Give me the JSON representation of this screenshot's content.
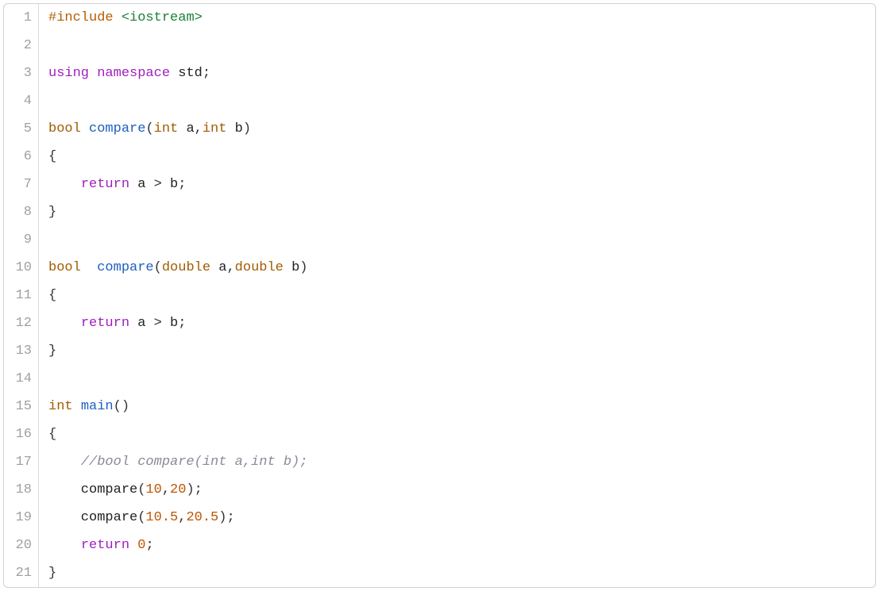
{
  "code": {
    "lines": [
      {
        "n": "1",
        "tokens": [
          {
            "cls": "tok-preproc",
            "txt": "#include"
          },
          {
            "cls": "tok-plain",
            "txt": " "
          },
          {
            "cls": "tok-incstr",
            "txt": "<iostream>"
          }
        ]
      },
      {
        "n": "2",
        "tokens": []
      },
      {
        "n": "3",
        "tokens": [
          {
            "cls": "tok-keyword",
            "txt": "using"
          },
          {
            "cls": "tok-plain",
            "txt": " "
          },
          {
            "cls": "tok-keyword",
            "txt": "namespace"
          },
          {
            "cls": "tok-plain",
            "txt": " std"
          },
          {
            "cls": "tok-punct",
            "txt": ";"
          }
        ]
      },
      {
        "n": "4",
        "tokens": []
      },
      {
        "n": "5",
        "tokens": [
          {
            "cls": "tok-type",
            "txt": "bool"
          },
          {
            "cls": "tok-plain",
            "txt": " "
          },
          {
            "cls": "tok-ident",
            "txt": "compare"
          },
          {
            "cls": "tok-punct",
            "txt": "("
          },
          {
            "cls": "tok-type",
            "txt": "int"
          },
          {
            "cls": "tok-plain",
            "txt": " a"
          },
          {
            "cls": "tok-punct",
            "txt": ","
          },
          {
            "cls": "tok-type",
            "txt": "int"
          },
          {
            "cls": "tok-plain",
            "txt": " b"
          },
          {
            "cls": "tok-punct",
            "txt": ")"
          }
        ]
      },
      {
        "n": "6",
        "tokens": [
          {
            "cls": "tok-punct",
            "txt": "{"
          }
        ]
      },
      {
        "n": "7",
        "tokens": [
          {
            "cls": "tok-plain",
            "txt": "    "
          },
          {
            "cls": "tok-keyword",
            "txt": "return"
          },
          {
            "cls": "tok-plain",
            "txt": " a "
          },
          {
            "cls": "tok-punct",
            "txt": ">"
          },
          {
            "cls": "tok-plain",
            "txt": " b"
          },
          {
            "cls": "tok-punct",
            "txt": ";"
          }
        ]
      },
      {
        "n": "8",
        "tokens": [
          {
            "cls": "tok-punct",
            "txt": "}"
          }
        ]
      },
      {
        "n": "9",
        "tokens": []
      },
      {
        "n": "10",
        "tokens": [
          {
            "cls": "tok-type",
            "txt": "bool"
          },
          {
            "cls": "tok-plain",
            "txt": "  "
          },
          {
            "cls": "tok-ident",
            "txt": "compare"
          },
          {
            "cls": "tok-punct",
            "txt": "("
          },
          {
            "cls": "tok-type",
            "txt": "double"
          },
          {
            "cls": "tok-plain",
            "txt": " a"
          },
          {
            "cls": "tok-punct",
            "txt": ","
          },
          {
            "cls": "tok-type",
            "txt": "double"
          },
          {
            "cls": "tok-plain",
            "txt": " b"
          },
          {
            "cls": "tok-punct",
            "txt": ")"
          }
        ]
      },
      {
        "n": "11",
        "tokens": [
          {
            "cls": "tok-punct",
            "txt": "{"
          }
        ]
      },
      {
        "n": "12",
        "tokens": [
          {
            "cls": "tok-plain",
            "txt": "    "
          },
          {
            "cls": "tok-keyword",
            "txt": "return"
          },
          {
            "cls": "tok-plain",
            "txt": " a "
          },
          {
            "cls": "tok-punct",
            "txt": ">"
          },
          {
            "cls": "tok-plain",
            "txt": " b"
          },
          {
            "cls": "tok-punct",
            "txt": ";"
          }
        ]
      },
      {
        "n": "13",
        "tokens": [
          {
            "cls": "tok-punct",
            "txt": "}"
          }
        ]
      },
      {
        "n": "14",
        "tokens": []
      },
      {
        "n": "15",
        "tokens": [
          {
            "cls": "tok-type",
            "txt": "int"
          },
          {
            "cls": "tok-plain",
            "txt": " "
          },
          {
            "cls": "tok-ident",
            "txt": "main"
          },
          {
            "cls": "tok-punct",
            "txt": "()"
          }
        ]
      },
      {
        "n": "16",
        "tokens": [
          {
            "cls": "tok-punct",
            "txt": "{"
          }
        ]
      },
      {
        "n": "17",
        "tokens": [
          {
            "cls": "tok-plain",
            "txt": "    "
          },
          {
            "cls": "tok-comment",
            "txt": "//bool compare(int a,int b);"
          }
        ]
      },
      {
        "n": "18",
        "tokens": [
          {
            "cls": "tok-plain",
            "txt": "    compare"
          },
          {
            "cls": "tok-punct",
            "txt": "("
          },
          {
            "cls": "tok-num",
            "txt": "10"
          },
          {
            "cls": "tok-punct",
            "txt": ","
          },
          {
            "cls": "tok-num",
            "txt": "20"
          },
          {
            "cls": "tok-punct",
            "txt": ");"
          }
        ]
      },
      {
        "n": "19",
        "tokens": [
          {
            "cls": "tok-plain",
            "txt": "    compare"
          },
          {
            "cls": "tok-punct",
            "txt": "("
          },
          {
            "cls": "tok-num",
            "txt": "10.5"
          },
          {
            "cls": "tok-punct",
            "txt": ","
          },
          {
            "cls": "tok-num",
            "txt": "20.5"
          },
          {
            "cls": "tok-punct",
            "txt": ");"
          }
        ]
      },
      {
        "n": "20",
        "tokens": [
          {
            "cls": "tok-plain",
            "txt": "    "
          },
          {
            "cls": "tok-keyword",
            "txt": "return"
          },
          {
            "cls": "tok-plain",
            "txt": " "
          },
          {
            "cls": "tok-num",
            "txt": "0"
          },
          {
            "cls": "tok-punct",
            "txt": ";"
          }
        ]
      },
      {
        "n": "21",
        "tokens": [
          {
            "cls": "tok-punct",
            "txt": "}"
          }
        ]
      }
    ]
  }
}
